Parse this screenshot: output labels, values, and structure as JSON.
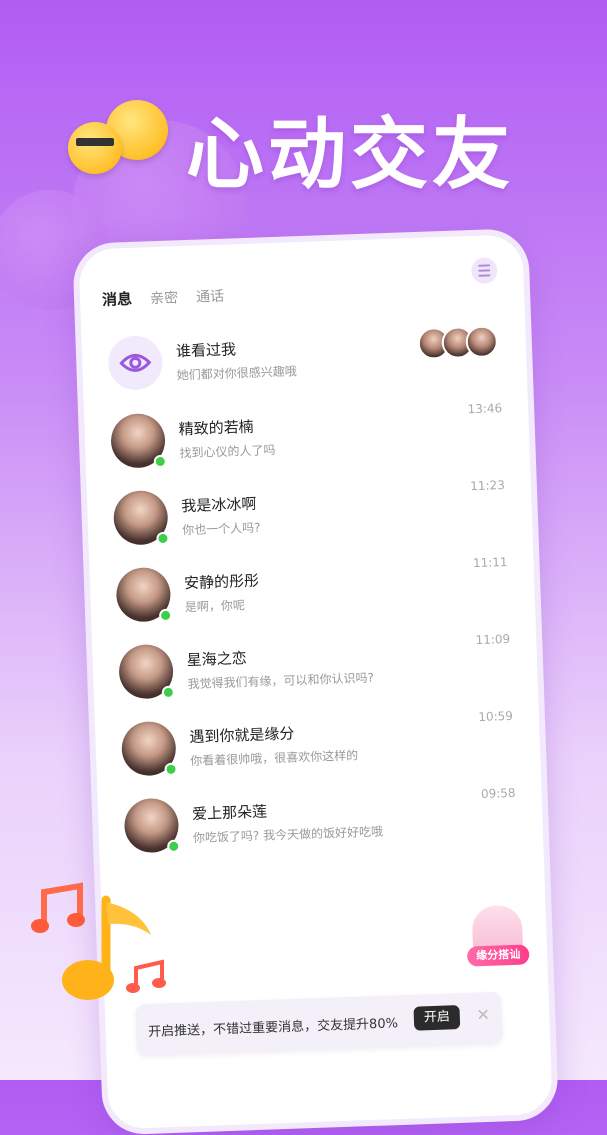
{
  "hero": {
    "title": "心动交友"
  },
  "tabs": [
    {
      "label": "消息"
    },
    {
      "label": "亲密"
    },
    {
      "label": "通话"
    }
  ],
  "visitors": {
    "title": "谁看过我",
    "subtitle": "她们都对你很感兴趣哦"
  },
  "conversations": [
    {
      "name": "精致的若楠",
      "preview": "找到心仪的人了吗",
      "time": "13:46"
    },
    {
      "name": "我是冰冰啊",
      "preview": "你也一个人吗?",
      "time": "11:23"
    },
    {
      "name": "安静的彤彤",
      "preview": "是啊，你呢",
      "time": "11:11"
    },
    {
      "name": "星海之恋",
      "preview": "我觉得我们有缘，可以和你认识吗?",
      "time": "11:09"
    },
    {
      "name": "遇到你就是缘分",
      "preview": "你看着很帅哦，很喜欢你这样的",
      "time": "10:59"
    },
    {
      "name": "爱上那朵莲",
      "preview": "你吃饭了吗? 我今天做的饭好好吃哦",
      "time": "09:58"
    }
  ],
  "match_badge": {
    "label": "缘分搭讪"
  },
  "push_bar": {
    "text": "开启推送，不错过重要消息，交友提升80%",
    "button": "开启",
    "close": "✕"
  },
  "colors": {
    "accent": "#b15cf3",
    "online": "#3ecf4a",
    "badge": "#ff3d8b"
  }
}
